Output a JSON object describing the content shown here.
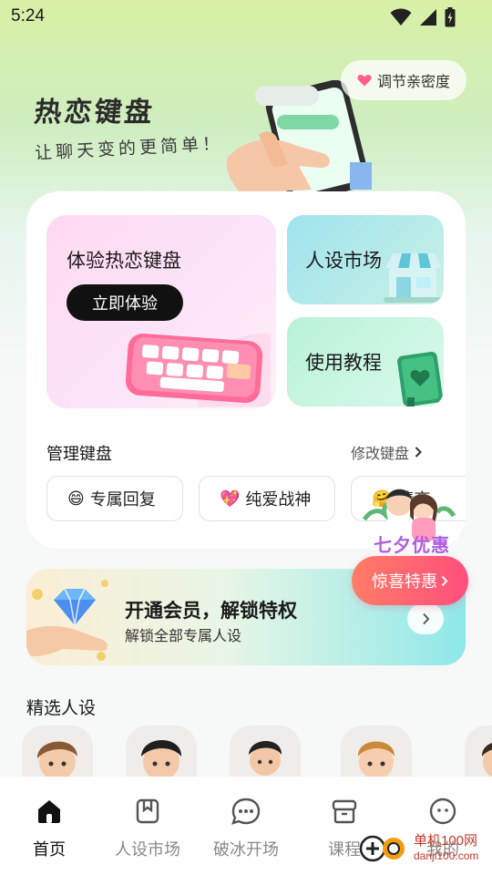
{
  "status_bar": {
    "time": "5:24"
  },
  "hero": {
    "title": "热恋键盘",
    "subtitle": "让聊天变的更简单！",
    "intimacy_button": "调节亲密度"
  },
  "main_card": {
    "experience": {
      "title": "体验热恋键盘",
      "button": "立即体验"
    },
    "market": {
      "label": "人设市场"
    },
    "tutorial": {
      "label": "使用教程"
    },
    "manage": {
      "title": "管理键盘",
      "modify_link": "修改键盘"
    },
    "chips": [
      {
        "emoji": "😄",
        "label": "专属回复"
      },
      {
        "emoji": "💖",
        "label": "纯爱战神"
      },
      {
        "emoji": "🤗",
        "label": "情商"
      }
    ]
  },
  "promo": {
    "qixi": "七夕优惠",
    "surprise_button": "惊喜特惠"
  },
  "vip_banner": {
    "title": "开通会员，解锁特权",
    "subtitle": "解锁全部专属人设"
  },
  "featured": {
    "title": "精选人设"
  },
  "bottom_nav": {
    "items": [
      {
        "label": "首页",
        "icon": "home-icon",
        "active": true
      },
      {
        "label": "人设市场",
        "icon": "bookmark-card-icon",
        "active": false
      },
      {
        "label": "破冰开场",
        "icon": "chat-bubble-icon",
        "active": false
      },
      {
        "label": "课程",
        "icon": "archive-box-icon",
        "active": false
      },
      {
        "label": "我的",
        "icon": "face-icon",
        "active": false
      }
    ]
  },
  "watermark": {
    "name": "单机100网",
    "url": "danji100.com"
  },
  "colors": {
    "accent_pink": "#ff4f7d",
    "qixi_purple": "#b05ee0",
    "dark_button": "#111111"
  }
}
